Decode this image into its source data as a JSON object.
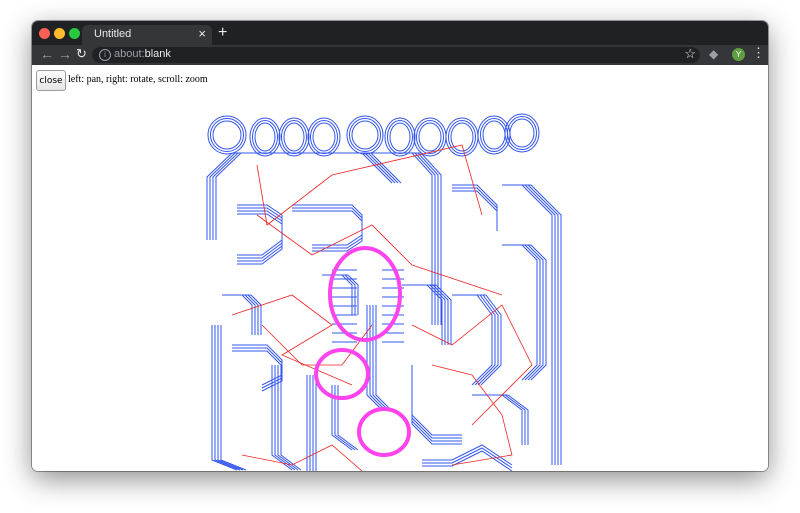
{
  "tab": {
    "title": "Untitled",
    "close_glyph": "×",
    "new_tab_glyph": "+"
  },
  "toolbar": {
    "back_glyph": "←",
    "forward_glyph": "→",
    "reload_glyph": "↻",
    "url_prefix": "about:",
    "url_rest": "blank",
    "bookmark_glyph": "☆",
    "avatar_letter": "Y",
    "menu_glyph": "⋮"
  },
  "page": {
    "close_label": "close",
    "hint": "left: pan, right: rotate, scroll: zoom"
  },
  "colors": {
    "trace": "#3355ee",
    "path": "#ee2222",
    "highlight": "#ff44ee",
    "chrome_dark": "#202124",
    "chrome_tab": "#35363a"
  },
  "icons": [
    "info-icon",
    "star-icon",
    "extension-icon",
    "avatar-icon",
    "menu-icon"
  ]
}
